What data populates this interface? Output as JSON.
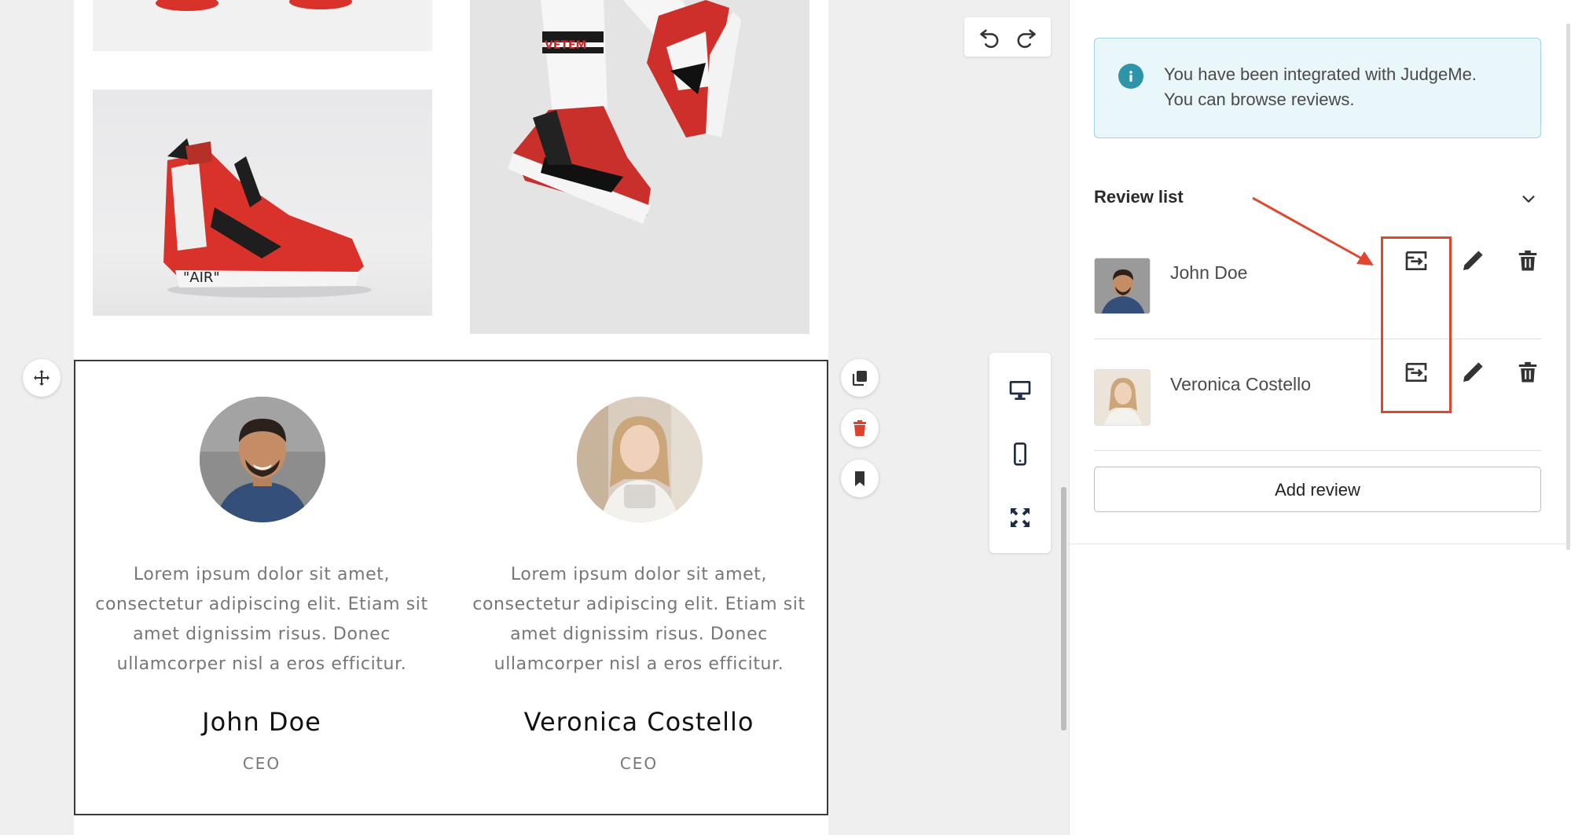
{
  "canvas": {
    "testimonials": [
      {
        "name": "John Doe",
        "role": "CEO",
        "quote": "Lorem ipsum dolor sit amet, consectetur adipiscing elit. Etiam sit amet dignissim risus. Donec ullamcorper nisl a eros efficitur."
      },
      {
        "name": "Veronica Costello",
        "role": "CEO",
        "quote": "Lorem ipsum dolor sit amet, consectetur adipiscing elit. Etiam sit amet dignissim risus. Donec ullamcorper nisl a eros efficitur."
      }
    ],
    "shoe_text": "\"AIR\""
  },
  "panel": {
    "info_line1": "You have been integrated with JudgeMe.",
    "info_line2": "You can browse reviews.",
    "section_title": "Review list",
    "reviews": [
      {
        "name": "John Doe"
      },
      {
        "name": "Veronica Costello"
      }
    ],
    "add_review_label": "Add review"
  },
  "colors": {
    "accent_red": "#e0472f",
    "info_teal": "#2e95a8",
    "info_bg": "#e9f6fa"
  }
}
